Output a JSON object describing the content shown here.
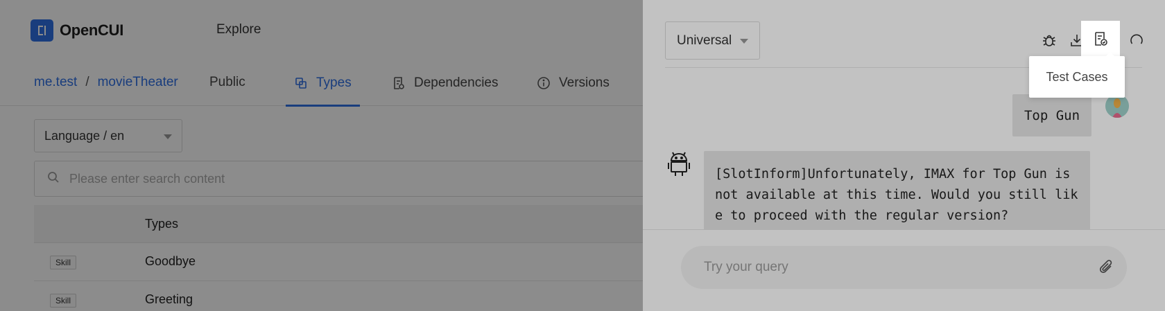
{
  "app": {
    "logo_text": "OpenCUI",
    "nav": {
      "explore": "Explore"
    },
    "breadcrumb": {
      "org": "me.test",
      "separator": "/",
      "project": "movieTheater"
    },
    "visibility": "Public",
    "tabs": [
      {
        "label": "Types",
        "icon": "types-icon",
        "active": true
      },
      {
        "label": "Dependencies",
        "icon": "dependencies-icon",
        "active": false
      },
      {
        "label": "Versions",
        "icon": "info-icon",
        "active": false
      }
    ],
    "language_select": "Language / en",
    "search": {
      "placeholder": "Please enter search content"
    },
    "table": {
      "header": "Types",
      "rows": [
        {
          "badge": "Skill",
          "name": "Goodbye"
        },
        {
          "badge": "Skill",
          "name": "Greeting"
        }
      ]
    }
  },
  "drawer": {
    "language": "Universal",
    "toolbar": [
      {
        "name": "bug-icon"
      },
      {
        "name": "download-icon"
      },
      {
        "name": "test-cases-icon"
      },
      {
        "name": "reset-icon"
      }
    ],
    "tooltip": "Test Cases",
    "messages": {
      "user": "Top Gun",
      "bot": "[SlotInform]Unfortunately, IMAX for Top Gun is not available at this time. Would you still like to proceed with the regular version?"
    },
    "composer": {
      "placeholder": "Try your query"
    }
  },
  "colors": {
    "accent": "#2f6fe4",
    "overlay": "rgba(0,0,0,0.45)"
  }
}
